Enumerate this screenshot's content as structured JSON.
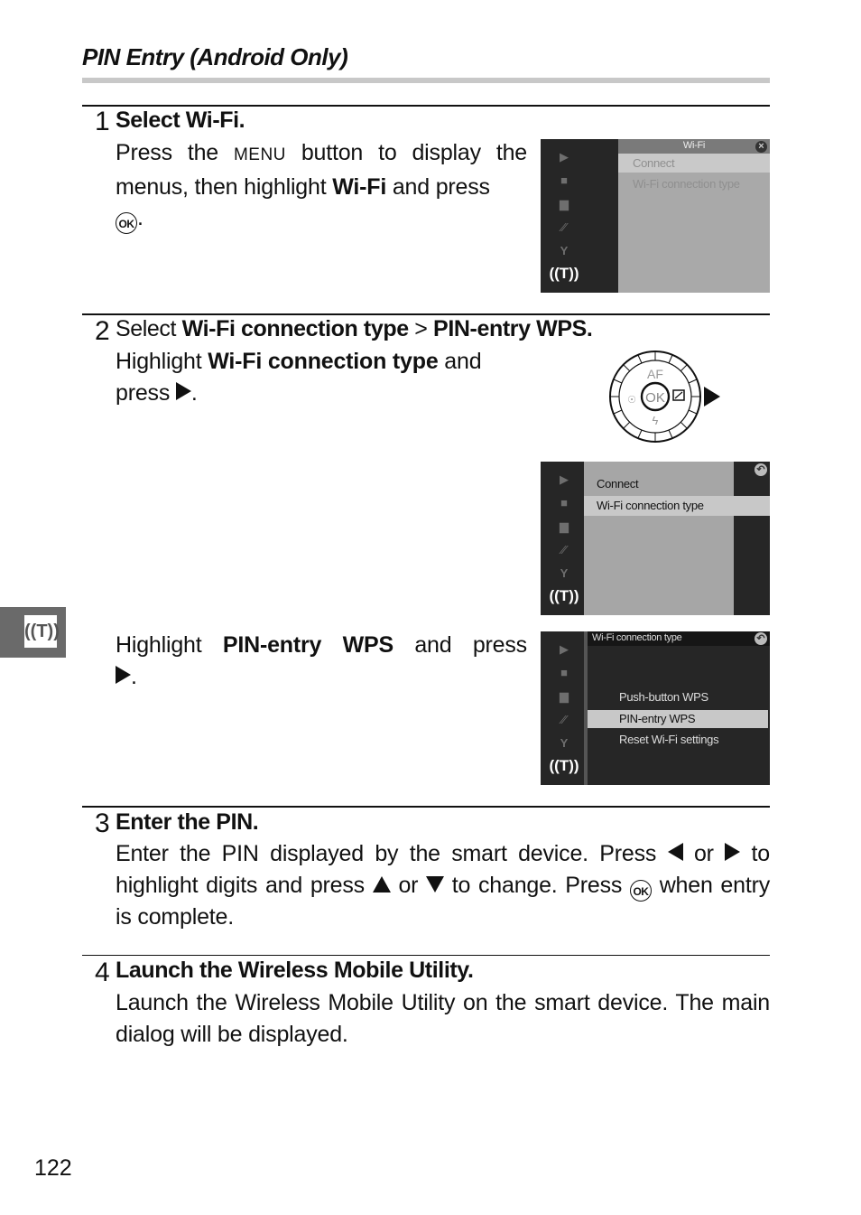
{
  "page": {
    "section_title": "PIN Entry (Android Only)",
    "page_number": "122",
    "side_tab_icon": "wifi-antenna-icon"
  },
  "steps": [
    {
      "number": "1",
      "heading": "Select Wi-Fi.",
      "body": {
        "t1": "Press the ",
        "menu_button": "MENU",
        "t2": " button to display the menus, then highlight ",
        "b1": "Wi-Fi",
        "t3": " and press ",
        "ok_button": "OK",
        "t4": "."
      },
      "screen": {
        "title": "Wi-Fi",
        "items": [
          "Connect",
          "Wi-Fi connection type"
        ],
        "highlighted": "Connect",
        "corner_icon": "close-icon"
      }
    },
    {
      "number": "2",
      "heading_parts": {
        "t1": "Select ",
        "b1": "Wi-Fi connection type",
        "t2": " > ",
        "b2": "PIN-entry WPS",
        "t3": "."
      },
      "body_a": {
        "t1": "Highlight ",
        "b1": "Wi-Fi connection type",
        "t2": " and press ",
        "t3": "."
      },
      "dial": {
        "top": "AF",
        "center": "OK",
        "bottom_icon": "flash-icon",
        "left_icon": "self-timer-icon",
        "right_icon": "exposure-comp-icon"
      },
      "screen_a": {
        "items": [
          "Connect",
          "Wi-Fi connection type"
        ],
        "highlighted": "Wi-Fi connection type",
        "corner_icon": "back-icon"
      },
      "body_b": {
        "t1": "Highlight ",
        "b1": "PIN-entry WPS",
        "t2": " and press ",
        "t3": "."
      },
      "screen_b": {
        "title": "Wi-Fi connection type",
        "items": [
          "Push-button WPS",
          "PIN-entry WPS",
          "Reset Wi-Fi settings"
        ],
        "highlighted": "PIN-entry WPS",
        "corner_icon": "back-icon"
      }
    },
    {
      "number": "3",
      "heading": "Enter the PIN.",
      "body": {
        "t1": "Enter the PIN displayed by the smart device.  Press ",
        "t2": " or ",
        "t3": " to highlight digits and press ",
        "t4": " or ",
        "t5": " to change.  Press ",
        "ok_button": "OK",
        "t6": " when entry is complete."
      }
    },
    {
      "number": "4",
      "heading": "Launch the Wireless Mobile Utility.",
      "body": "Launch the Wireless Mobile Utility on the smart device.  The main dialog will be displayed."
    }
  ],
  "camera_menu_sidebar": [
    {
      "icon": "playback-icon",
      "glyph": "▶"
    },
    {
      "icon": "camera-icon",
      "glyph": "■"
    },
    {
      "icon": "movie-icon",
      "glyph": "▆"
    },
    {
      "icon": "image-processing-icon",
      "glyph": "⁄⁄"
    },
    {
      "icon": "setup-wrench-icon",
      "glyph": "Y"
    },
    {
      "icon": "wifi-antenna-icon",
      "glyph": "((T))"
    }
  ]
}
